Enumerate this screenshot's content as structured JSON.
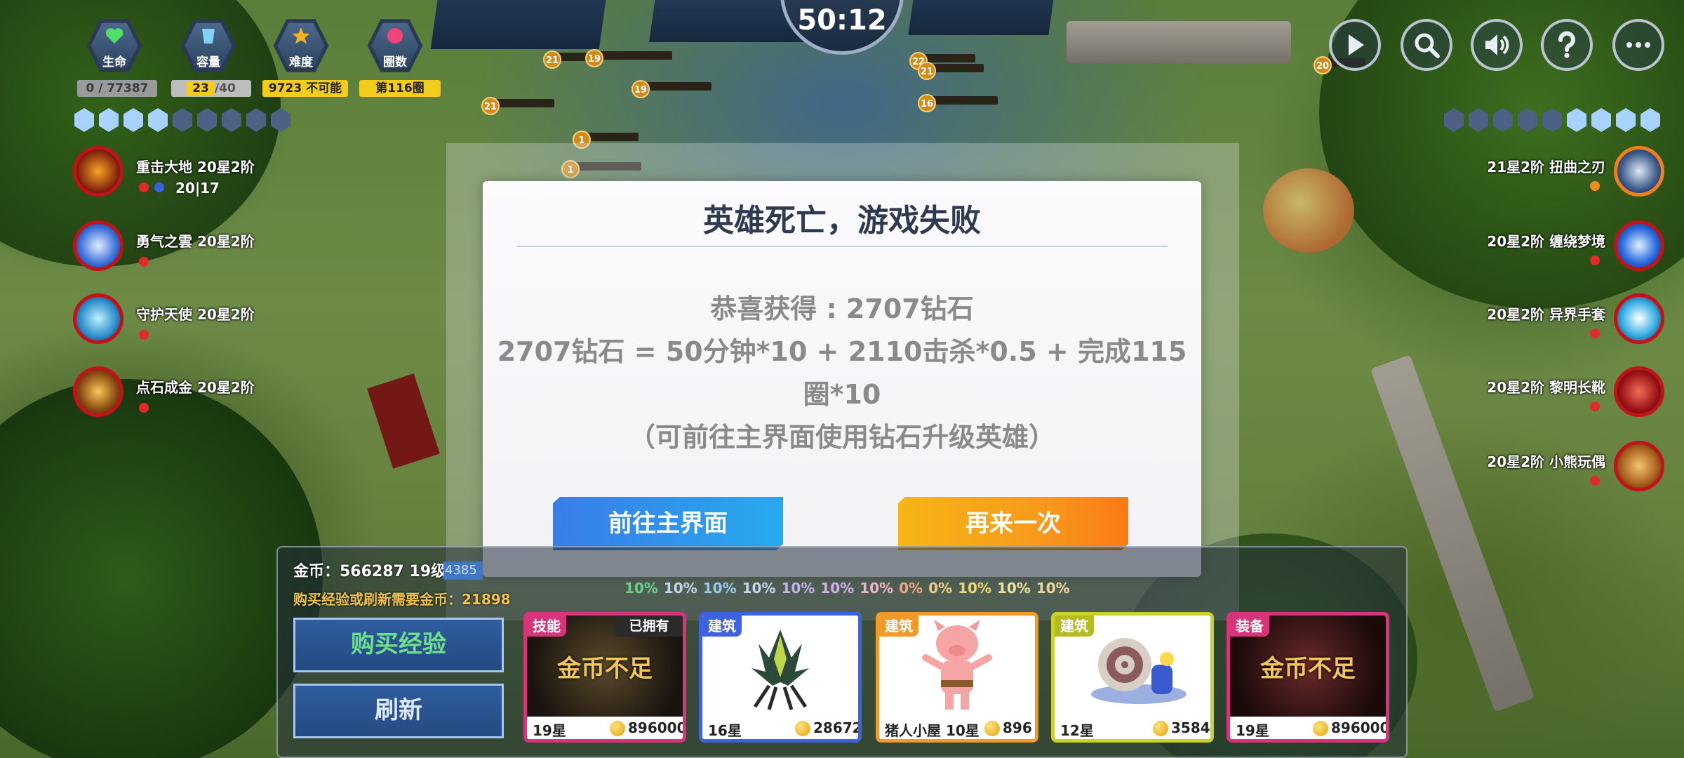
{
  "timer": "50:12",
  "stats": [
    {
      "label": "生命",
      "icon": "heart-icon",
      "value": "0 / 77387"
    },
    {
      "label": "容量",
      "icon": "cup-icon",
      "value_a": "23",
      "value_sep": "/",
      "value_b": "40"
    },
    {
      "label": "难度",
      "icon": "star-icon",
      "value": "9723 不可能"
    },
    {
      "label": "圈数",
      "icon": "circle-icon",
      "value": "第116圈"
    }
  ],
  "hero_skills": [
    {
      "name": "重击大地 20星2阶",
      "counter": "20|17",
      "icon": "ground-strike-icon"
    },
    {
      "name": "勇气之雲 20星2阶",
      "icon": "courage-cloud-icon"
    },
    {
      "name": "守护天使 20星2阶",
      "icon": "guardian-angel-icon"
    },
    {
      "name": "点石成金 20星2阶",
      "icon": "midas-touch-icon"
    }
  ],
  "equipment": [
    {
      "name": "21星2阶 扭曲之刃",
      "icon": "twisted-blade-icon"
    },
    {
      "name": "20星2阶 缠绕梦境",
      "icon": "dream-orb-icon"
    },
    {
      "name": "20星2阶 异界手套",
      "icon": "otherworld-glove-icon"
    },
    {
      "name": "20星2阶 黎明长靴",
      "icon": "dawn-boots-icon"
    },
    {
      "name": "20星2阶 小熊玩偶",
      "icon": "teddy-bear-icon"
    }
  ],
  "controls": [
    "play-icon",
    "search-icon",
    "sound-icon",
    "help-icon",
    "more-icon"
  ],
  "enemy_markers": [
    "21",
    "19",
    "19",
    "21",
    "1",
    "1",
    "22",
    "21",
    "16",
    "20"
  ],
  "modal": {
    "title": "英雄死亡，游戏失败",
    "line1": "恭喜获得 : 2707钻石",
    "line2": "2707钻石 = 50分钟*10 + 2110击杀*0.5 + 完成115圈*10",
    "line3": "（可前往主界面使用钻石升级英雄）",
    "home_button": "前往主界面",
    "retry_button": "再来一次"
  },
  "shop": {
    "gold_label": "金币：566287  19级",
    "xp_value": "4385",
    "need_gold": "购买经验或刷新需要金币：21898",
    "buy_xp": "购买经验",
    "refresh": "刷新",
    "odds": [
      "10%",
      "10%",
      "10%",
      "10%",
      "10%",
      "10%",
      "10%",
      "0%",
      "0%",
      "10%",
      "10%",
      "10%"
    ],
    "cards": [
      {
        "tag": "技能",
        "owned": "已拥有",
        "overlay": "金币不足",
        "stars": "19星",
        "price": "896000",
        "color": "#d8347a",
        "tag_color": "#d8347a"
      },
      {
        "tag": "建筑",
        "stars": "16星",
        "price": "28672",
        "color": "#3f63e0",
        "tag_color": "#3f63e0"
      },
      {
        "tag": "建筑",
        "stars": "猪人小屋 10星",
        "price": "896",
        "color": "#f09a2a",
        "tag_color": "#f09a2a"
      },
      {
        "tag": "建筑",
        "stars": "12星",
        "price": "3584",
        "color": "#c9d22b",
        "tag_color": "#b4bd1e"
      },
      {
        "tag": "装备",
        "overlay": "金币不足",
        "stars": "19星",
        "price": "896000",
        "color": "#d8347a",
        "tag_color": "#d8347a"
      }
    ]
  }
}
